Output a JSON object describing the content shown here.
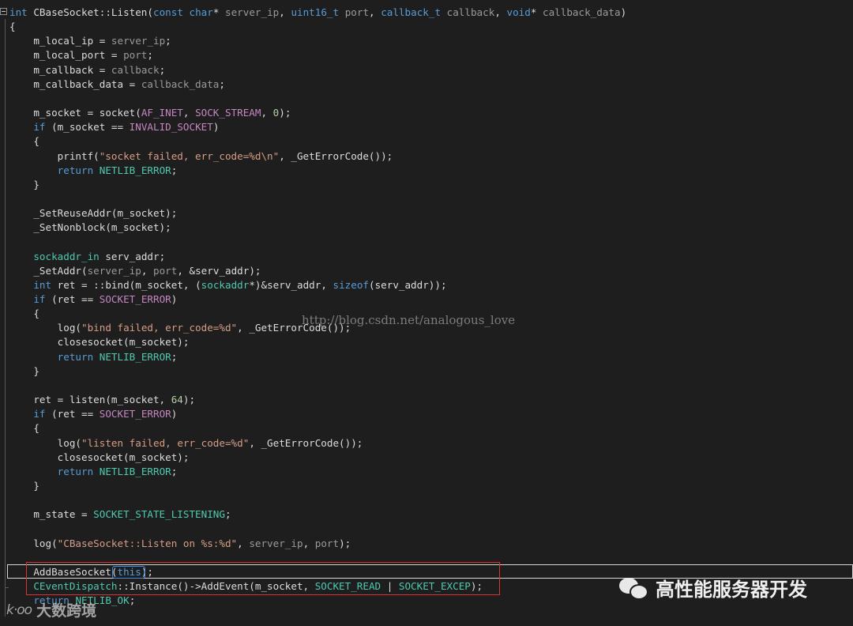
{
  "editor": {
    "lines": [
      [
        [
          "int",
          "kw"
        ],
        [
          " CBaseSocket::Listen(",
          "fn"
        ],
        [
          "const",
          "kw"
        ],
        [
          " ",
          "plain"
        ],
        [
          "char",
          "kw"
        ],
        [
          "* ",
          "plain"
        ],
        [
          "server_ip",
          "pr"
        ],
        [
          ", ",
          "plain"
        ],
        [
          "uint16_t",
          "kw"
        ],
        [
          " ",
          "plain"
        ],
        [
          "port",
          "pr"
        ],
        [
          ", ",
          "plain"
        ],
        [
          "callback_t",
          "kw"
        ],
        [
          " ",
          "plain"
        ],
        [
          "callback",
          "pr"
        ],
        [
          ", ",
          "plain"
        ],
        [
          "void",
          "kw"
        ],
        [
          "* ",
          "plain"
        ],
        [
          "callback_data",
          "pr"
        ],
        [
          ")",
          "plain"
        ]
      ],
      [
        [
          "{",
          "plain"
        ]
      ],
      [
        [
          "    m_local_ip = ",
          "plain"
        ],
        [
          "server_ip",
          "pr"
        ],
        [
          ";",
          "plain"
        ]
      ],
      [
        [
          "    m_local_port = ",
          "plain"
        ],
        [
          "port",
          "pr"
        ],
        [
          ";",
          "plain"
        ]
      ],
      [
        [
          "    m_callback = ",
          "plain"
        ],
        [
          "callback",
          "pr"
        ],
        [
          ";",
          "plain"
        ]
      ],
      [
        [
          "    m_callback_data = ",
          "plain"
        ],
        [
          "callback_data",
          "pr"
        ],
        [
          ";",
          "plain"
        ]
      ],
      [],
      [
        [
          "    m_socket = socket(",
          "plain"
        ],
        [
          "AF_INET",
          "mac"
        ],
        [
          ", ",
          "plain"
        ],
        [
          "SOCK_STREAM",
          "mac"
        ],
        [
          ", ",
          "plain"
        ],
        [
          "0",
          "num"
        ],
        [
          ");",
          "plain"
        ]
      ],
      [
        [
          "    ",
          "plain"
        ],
        [
          "if",
          "kw"
        ],
        [
          " (m_socket == ",
          "plain"
        ],
        [
          "INVALID_SOCKET",
          "mac"
        ],
        [
          ")",
          "plain"
        ]
      ],
      [
        [
          "    {",
          "plain"
        ]
      ],
      [
        [
          "        printf(",
          "plain"
        ],
        [
          "\"socket failed, err_code=%d\\n\"",
          "str"
        ],
        [
          ", _GetErrorCode());",
          "plain"
        ]
      ],
      [
        [
          "        ",
          "plain"
        ],
        [
          "return",
          "kw"
        ],
        [
          " ",
          "plain"
        ],
        [
          "NETLIB_ERROR",
          "ty"
        ],
        [
          ";",
          "plain"
        ]
      ],
      [
        [
          "    }",
          "plain"
        ]
      ],
      [],
      [
        [
          "    _SetReuseAddr(m_socket);",
          "plain"
        ]
      ],
      [
        [
          "    _SetNonblock(m_socket);",
          "plain"
        ]
      ],
      [],
      [
        [
          "    ",
          "plain"
        ],
        [
          "sockaddr_in",
          "ty"
        ],
        [
          " serv_addr;",
          "plain"
        ]
      ],
      [
        [
          "    _SetAddr(",
          "plain"
        ],
        [
          "server_ip",
          "pr"
        ],
        [
          ", ",
          "plain"
        ],
        [
          "port",
          "pr"
        ],
        [
          ", &serv_addr);",
          "plain"
        ]
      ],
      [
        [
          "    ",
          "plain"
        ],
        [
          "int",
          "kw"
        ],
        [
          " ret = ::bind(m_socket, (",
          "plain"
        ],
        [
          "sockaddr",
          "ty"
        ],
        [
          "*)&serv_addr, ",
          "plain"
        ],
        [
          "sizeof",
          "kw"
        ],
        [
          "(serv_addr));",
          "plain"
        ]
      ],
      [
        [
          "    ",
          "plain"
        ],
        [
          "if",
          "kw"
        ],
        [
          " (ret == ",
          "plain"
        ],
        [
          "SOCKET_ERROR",
          "mac"
        ],
        [
          ")",
          "plain"
        ]
      ],
      [
        [
          "    {",
          "plain"
        ]
      ],
      [
        [
          "        log(",
          "plain"
        ],
        [
          "\"bind failed, err_code=%d\"",
          "str"
        ],
        [
          ", _GetErrorCode());",
          "plain"
        ]
      ],
      [
        [
          "        closesocket(m_socket);",
          "plain"
        ]
      ],
      [
        [
          "        ",
          "plain"
        ],
        [
          "return",
          "kw"
        ],
        [
          " ",
          "plain"
        ],
        [
          "NETLIB_ERROR",
          "ty"
        ],
        [
          ";",
          "plain"
        ]
      ],
      [
        [
          "    }",
          "plain"
        ]
      ],
      [],
      [
        [
          "    ret = listen(m_socket, ",
          "plain"
        ],
        [
          "64",
          "num"
        ],
        [
          ");",
          "plain"
        ]
      ],
      [
        [
          "    ",
          "plain"
        ],
        [
          "if",
          "kw"
        ],
        [
          " (ret == ",
          "plain"
        ],
        [
          "SOCKET_ERROR",
          "mac"
        ],
        [
          ")",
          "plain"
        ]
      ],
      [
        [
          "    {",
          "plain"
        ]
      ],
      [
        [
          "        log(",
          "plain"
        ],
        [
          "\"listen failed, err_code=%d\"",
          "str"
        ],
        [
          ", _GetErrorCode());",
          "plain"
        ]
      ],
      [
        [
          "        closesocket(m_socket);",
          "plain"
        ]
      ],
      [
        [
          "        ",
          "plain"
        ],
        [
          "return",
          "kw"
        ],
        [
          " ",
          "plain"
        ],
        [
          "NETLIB_ERROR",
          "ty"
        ],
        [
          ";",
          "plain"
        ]
      ],
      [
        [
          "    }",
          "plain"
        ]
      ],
      [],
      [
        [
          "    m_state = ",
          "plain"
        ],
        [
          "SOCKET_STATE_LISTENING",
          "ty"
        ],
        [
          ";",
          "plain"
        ]
      ],
      [],
      [
        [
          "    log(",
          "plain"
        ],
        [
          "\"CBaseSocket::Listen on %s:%d\"",
          "str"
        ],
        [
          ", ",
          "plain"
        ],
        [
          "server_ip",
          "pr"
        ],
        [
          ", ",
          "plain"
        ],
        [
          "port",
          "pr"
        ],
        [
          ");",
          "plain"
        ]
      ],
      [],
      [
        [
          "    AddBaseSocket(",
          "plain"
        ],
        [
          "this",
          "kw"
        ],
        [
          ");",
          "plain"
        ]
      ],
      [
        [
          "    ",
          "plain"
        ],
        [
          "CEventDispatch",
          "ty"
        ],
        [
          "::Instance()->AddEvent(m_socket, ",
          "plain"
        ],
        [
          "SOCKET_READ",
          "ty"
        ],
        [
          " | ",
          "plain"
        ],
        [
          "SOCKET_EXCEP",
          "ty"
        ],
        [
          ");",
          "plain"
        ]
      ],
      [
        [
          "    ",
          "plain"
        ],
        [
          "return",
          "kw"
        ],
        [
          " ",
          "plain"
        ],
        [
          "NETLIB_OK",
          "ty"
        ],
        [
          ";",
          "plain"
        ]
      ]
    ]
  },
  "watermark": "http://blog.csdn.net/analogous_love",
  "wechat_label": "高性能服务器开发",
  "brand_logo": "k·oo",
  "brand_text": "大数跨境"
}
